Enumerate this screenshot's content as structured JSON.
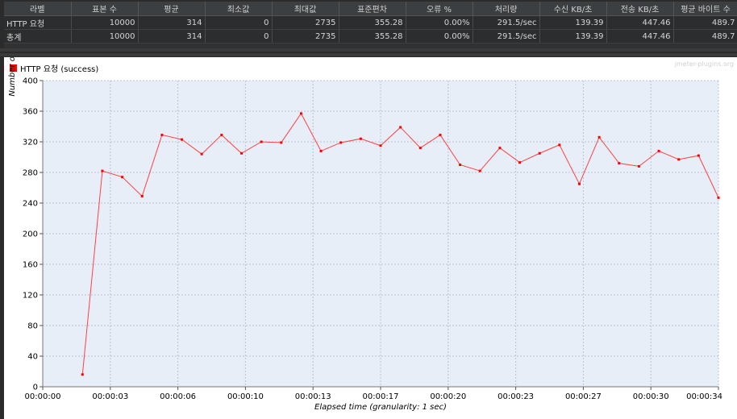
{
  "summary": {
    "headers": [
      "라벨",
      "표본 수",
      "평균",
      "최소값",
      "최대값",
      "표준편차",
      "오류 %",
      "처리량",
      "수신 KB/초",
      "전송 KB/초",
      "평균 바이트 수"
    ],
    "rows": [
      [
        "HTTP 요청",
        "10000",
        "314",
        "0",
        "2735",
        "355.28",
        "0.00%",
        "291.5/sec",
        "139.39",
        "447.46",
        "489.7"
      ],
      [
        "총계",
        "10000",
        "314",
        "0",
        "2735",
        "355.28",
        "0.00%",
        "291.5/sec",
        "139.39",
        "447.46",
        "489.7"
      ]
    ]
  },
  "watermark": "jmeter-plugins.org",
  "colors": {
    "series": "#ff4040",
    "legend_swatch": "#ff0000",
    "plot_bg": "#e8eef8",
    "grid": "#b8c4d4"
  },
  "chart_data": {
    "type": "line",
    "xlabel": "Elapsed time (granularity: 1 sec)",
    "ylabel": "Number of transactions /sec",
    "ylim": [
      0,
      400
    ],
    "xlim": [
      0,
      34
    ],
    "yticks": [
      0,
      40,
      80,
      120,
      160,
      200,
      240,
      280,
      320,
      360,
      400
    ],
    "xticks": [
      0,
      3.4,
      6.8,
      10.2,
      13.6,
      17,
      20.4,
      23.8,
      27.2,
      30.6,
      34
    ],
    "xtick_labels": [
      "00:00:00",
      "00:00:03",
      "00:00:06",
      "00:00:10",
      "00:00:13",
      "00:00:17",
      "00:00:20",
      "00:00:23",
      "00:00:27",
      "00:00:30",
      "00:00:34"
    ],
    "legend": "top-left",
    "grid": true,
    "series": [
      {
        "name": "HTTP 요청 (success)",
        "x": [
          2,
          3,
          4,
          5,
          6,
          7,
          8,
          9,
          10,
          11,
          12,
          13,
          14,
          15,
          16,
          17,
          18,
          19,
          20,
          21,
          22,
          23,
          24,
          25,
          26,
          27,
          28,
          29,
          30,
          31,
          32,
          33,
          34
        ],
        "y": [
          16,
          282,
          274,
          249,
          329,
          323,
          304,
          329,
          305,
          320,
          319,
          357,
          308,
          319,
          324,
          315,
          339,
          312,
          329,
          290,
          282,
          312,
          293,
          305,
          316,
          265,
          326,
          292,
          288,
          308,
          297,
          302,
          247
        ]
      }
    ]
  }
}
